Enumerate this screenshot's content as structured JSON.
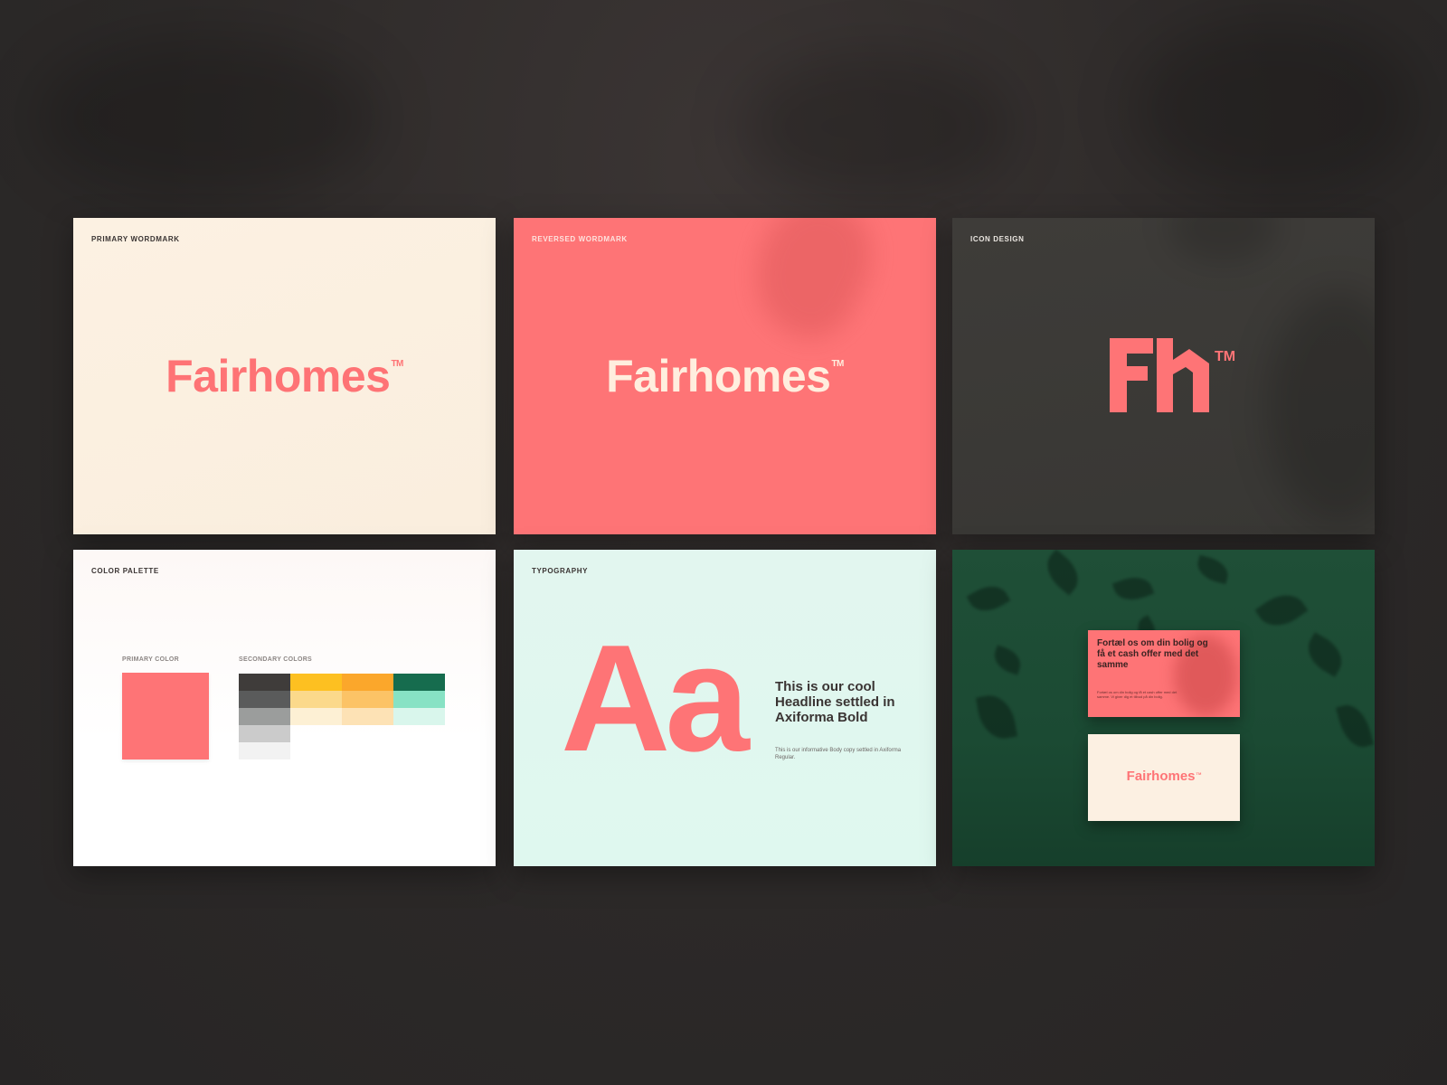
{
  "colors": {
    "brand_coral": "#fe7476",
    "cream": "#fcf0e2",
    "charcoal": "#3d3b38",
    "mint": "#e0f7ef",
    "forest": "#1e4e36"
  },
  "cards": {
    "primary_wordmark": {
      "label": "PRIMARY WORDMARK",
      "wordmark": "Fairhomes",
      "tm": "TM"
    },
    "reversed_wordmark": {
      "label": "REVERSED WORDMARK",
      "wordmark": "Fairhomes",
      "tm": "TM"
    },
    "icon_design": {
      "label": "ICON DESIGN",
      "tm": "TM"
    },
    "color_palette": {
      "label": "COLOR PALETTE",
      "primary_label": "PRIMARY COLOR",
      "secondary_label": "SECONDARY COLORS",
      "primary_color": "#fe7476",
      "secondary_colors": [
        [
          "#3f3c3a",
          "#5a5b5b",
          "#9b9d9c",
          "#cbcbcb",
          "#f2f2f2"
        ],
        [
          "#fdc021",
          "#fbd98b",
          "#fdf0d4"
        ],
        [
          "#fba72b",
          "#fcc366",
          "#fde2b5"
        ],
        [
          "#166c4e",
          "#87e2c4",
          "#d9f6ec"
        ]
      ]
    },
    "typography": {
      "label": "TYPOGRAPHY",
      "specimen": "Aa",
      "headline": "This is our cool Headline settled in Axiforma Bold",
      "body": "This is our informative Body copy settled in Axiforma Regular."
    },
    "mockup": {
      "card_headline": "Fortæl os om din bolig og få et cash offer med det samme",
      "card_body": "Fortæl os om din bolig og få et cash offer med det samme. Vi giver dig et tilbud på din bolig.",
      "wordmark": "Fairhomes",
      "tm": "TM"
    }
  }
}
